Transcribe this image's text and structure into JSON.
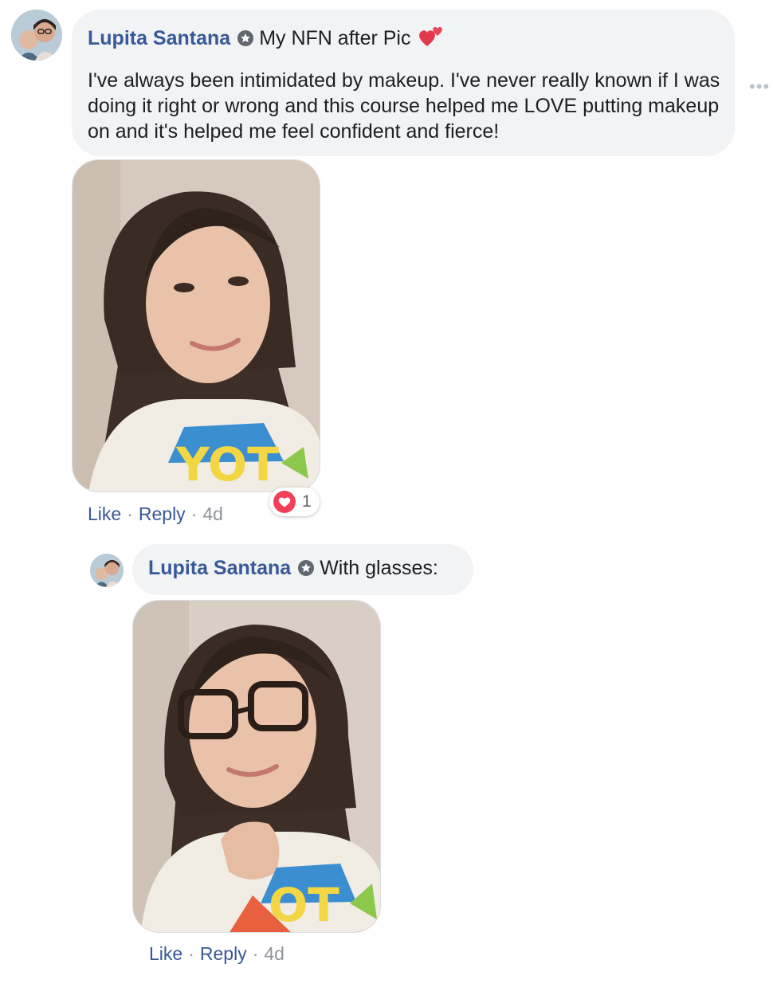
{
  "comment": {
    "author": "Lupita Santana",
    "title_text": "My NFN after Pic",
    "title_emoji": "💕",
    "body": "I've always been intimidated by makeup. I've never really known if I was doing it right or wrong and this course helped me LOVE putting makeup on and it's helped me feel confident and fierce!",
    "actions": {
      "like": "Like",
      "reply": "Reply",
      "time": "4d",
      "separator": "·"
    },
    "reaction": {
      "icon": "heart-icon",
      "count": "1",
      "color": "#f33e58"
    },
    "more": "•••"
  },
  "reply": {
    "author": "Lupita Santana",
    "text": "With glasses:",
    "actions": {
      "like": "Like",
      "reply": "Reply",
      "time": "4d",
      "separator": "·"
    }
  },
  "colors": {
    "name": "#385898",
    "bubble": "#f2f3f5",
    "meta": "#90949c"
  }
}
